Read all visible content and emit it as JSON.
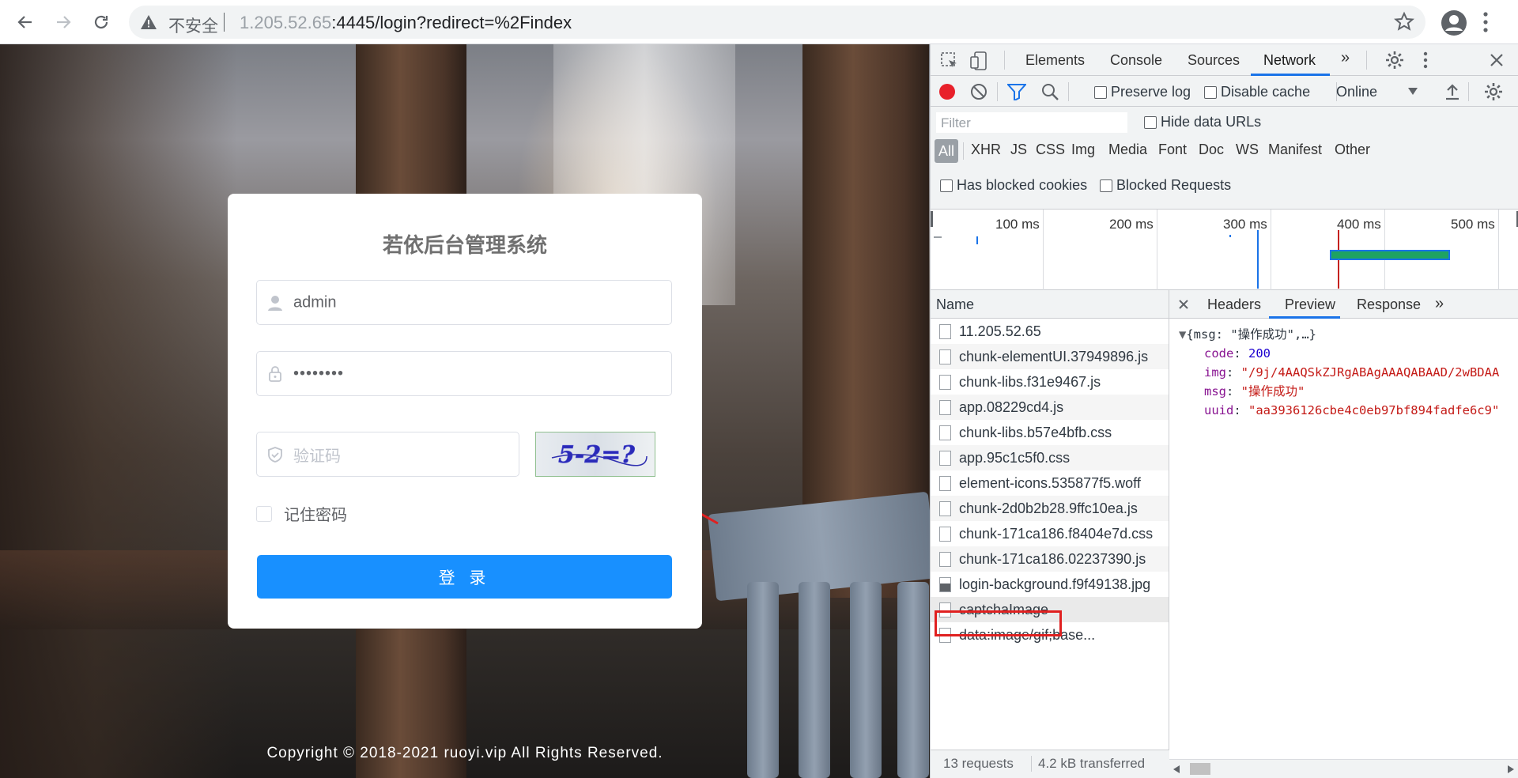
{
  "browser": {
    "security_label": "不安全",
    "url_masked": "1.205.52.65",
    "url_rest": ":4445/login?redirect=%2Findex"
  },
  "login": {
    "title": "若依后台管理系统",
    "username_value": "admin",
    "password_value": "••••••••",
    "captcha_placeholder": "验证码",
    "captcha_text": "5-2=?",
    "remember_label": "记住密码",
    "login_button": "登 录",
    "copyright": "Copyright © 2018-2021 ruoyi.vip All Rights Reserved."
  },
  "devtools": {
    "tabs": [
      "Elements",
      "Console",
      "Sources",
      "Network"
    ],
    "active_tab": "Network",
    "toolbar": {
      "preserve_log": "Preserve log",
      "disable_cache": "Disable cache",
      "throttle": "Online"
    },
    "filter": {
      "placeholder": "Filter",
      "hide_data_urls": "Hide data URLs",
      "types": [
        "All",
        "XHR",
        "JS",
        "CSS",
        "Img",
        "Media",
        "Font",
        "Doc",
        "WS",
        "Manifest",
        "Other"
      ],
      "has_blocked_cookies": "Has blocked cookies",
      "blocked_requests": "Blocked Requests"
    },
    "timeline_labels": [
      "100 ms",
      "200 ms",
      "300 ms",
      "400 ms",
      "500 ms"
    ],
    "name_header": "Name",
    "requests": [
      "11.205.52.65",
      "chunk-elementUI.37949896.js",
      "chunk-libs.f31e9467.js",
      "app.08229cd4.js",
      "chunk-libs.b57e4bfb.css",
      "app.95c1c5f0.css",
      "element-icons.535877f5.woff",
      "chunk-2d0b2b28.9ffc10ea.js",
      "chunk-171ca186.f8404e7d.css",
      "chunk-171ca186.02237390.js",
      "login-background.f9f49138.jpg",
      "captchaImage",
      "data:image/gif;base..."
    ],
    "status": {
      "requests": "13 requests",
      "transferred": "4.2 kB transferred"
    },
    "detail_tabs": [
      "Headers",
      "Preview",
      "Response"
    ],
    "active_detail_tab": "Preview",
    "preview": {
      "summary": "{msg: \"操作成功\",…}",
      "code_key": "code",
      "code_val": "200",
      "img_key": "img",
      "img_val": "\"/9j/4AAQSkZJRgABAgAAAQABAAD/2wBDAA",
      "msg_key": "msg",
      "msg_val": "\"操作成功\"",
      "uuid_key": "uuid",
      "uuid_val": "\"aa3936126cbe4c0eb97bf894fadfe6c9\""
    }
  },
  "colors": {
    "accent_blue": "#1890ff",
    "devtools_blue": "#1a73e8",
    "record_red": "#e8202a",
    "highlight_red": "#e02020"
  }
}
